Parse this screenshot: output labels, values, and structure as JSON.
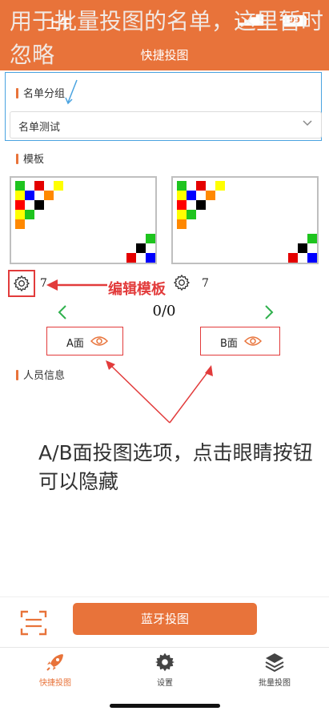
{
  "status_bar": {
    "time": "上午",
    "battery": "99"
  },
  "header": {
    "title": "快捷投图",
    "annotation": "用于批量投图的名单，这里暂时忽略"
  },
  "group_section": {
    "label": "名单分组",
    "select_value": "名单测试"
  },
  "template_section": {
    "label": "模板",
    "left_count": "7",
    "right_count": "7",
    "annotation": "编辑模板",
    "pager": "0/0"
  },
  "face_buttons": {
    "a_label": "A面",
    "b_label": "B面"
  },
  "person_section": {
    "label": "人员信息"
  },
  "annotation_bottom": "A/B面投图选项，点击眼睛按钮可以隐藏",
  "action": {
    "bluetooth_button": "蓝牙投图"
  },
  "tabs": [
    {
      "label": "快捷投图",
      "icon": "rocket-icon",
      "active": true
    },
    {
      "label": "设置",
      "icon": "gear-icon",
      "active": false
    },
    {
      "label": "批量投图",
      "icon": "layers-icon",
      "active": false
    }
  ],
  "colors": {
    "accent": "#E8733A",
    "annotation_red": "#e23b3b",
    "highlight_blue": "#4aa3e0",
    "nav_green": "#2fb14d"
  }
}
